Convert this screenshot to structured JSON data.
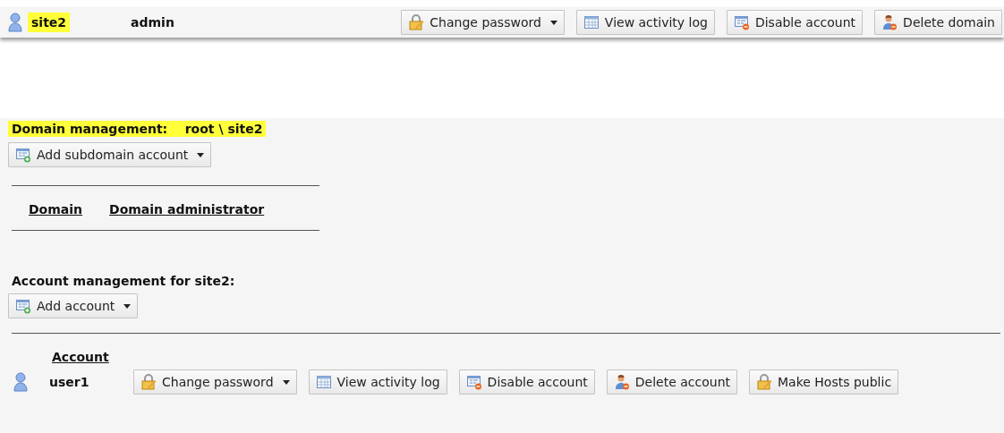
{
  "domain_row": {
    "name": "site2",
    "highlighted": true,
    "administrator": "admin",
    "buttons": [
      {
        "label": "Change password",
        "kind": "lock",
        "dropdown": true
      },
      {
        "label": "View activity log",
        "kind": "log",
        "dropdown": false
      },
      {
        "label": "Disable account",
        "kind": "disable",
        "dropdown": false
      },
      {
        "label": "Delete domain",
        "kind": "delete",
        "dropdown": false
      }
    ]
  },
  "domain_management": {
    "heading": "Domain management:",
    "path": "root \\ site2",
    "highlighted": true,
    "add_button": {
      "label": "Add subdomain account",
      "kind": "add",
      "dropdown": true
    },
    "columns": [
      "Domain",
      "Domain administrator"
    ]
  },
  "account_management": {
    "heading": "Account management for site2:",
    "add_button": {
      "label": "Add account",
      "kind": "add",
      "dropdown": true
    },
    "columns": [
      "Account"
    ],
    "rows": [
      {
        "name": "user1",
        "buttons": [
          {
            "label": "Change password",
            "kind": "lock",
            "dropdown": true
          },
          {
            "label": "View activity log",
            "kind": "log",
            "dropdown": false
          },
          {
            "label": "Disable account",
            "kind": "disable",
            "dropdown": false
          },
          {
            "label": "Delete account",
            "kind": "delete",
            "dropdown": false
          },
          {
            "label": "Make Hosts public",
            "kind": "lock",
            "dropdown": false
          }
        ]
      }
    ]
  }
}
